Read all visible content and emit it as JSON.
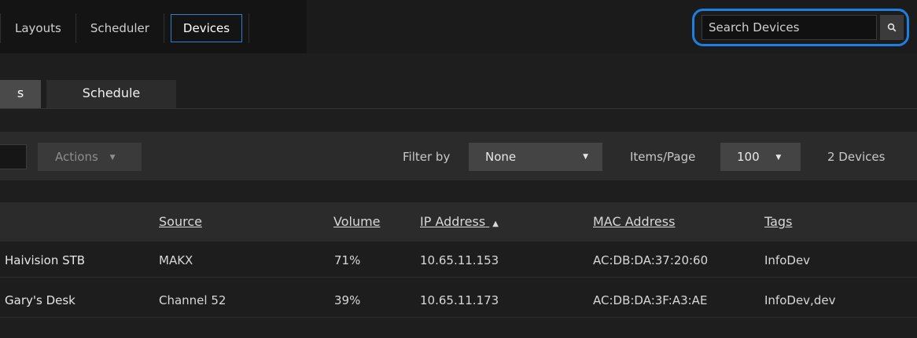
{
  "nav": {
    "items": [
      {
        "label": "Layouts"
      },
      {
        "label": "Scheduler"
      },
      {
        "label": "Devices",
        "active": true
      }
    ]
  },
  "search": {
    "placeholder": "Search Devices",
    "value": "",
    "icon": "search-icon"
  },
  "tabs": [
    {
      "label": "s",
      "active": true
    },
    {
      "label": "Schedule",
      "active": false
    }
  ],
  "toolbar": {
    "actions_label": "Actions",
    "filter_label": "Filter by",
    "filter_value": "None",
    "items_label": "Items/Page",
    "items_value": "100",
    "device_count": "2 Devices"
  },
  "table": {
    "columns": [
      "Source",
      "Volume",
      "IP Address",
      "MAC Address",
      "Tags"
    ],
    "sort_indicator": "▲",
    "rows": [
      {
        "name": "Haivision STB",
        "source": "MAKX",
        "volume": "71%",
        "ip": "10.65.11.153",
        "mac": "AC:DB:DA:37:20:60",
        "tags": "InfoDev"
      },
      {
        "name": "Gary's Desk",
        "source": "Channel 52",
        "volume": "39%",
        "ip": "10.65.11.173",
        "mac": "AC:DB:DA:3F:A3:AE",
        "tags": "InfoDev,dev"
      }
    ]
  },
  "colors": {
    "accent": "#1f7fe0",
    "active_nav_border": "#2f7fc8"
  }
}
